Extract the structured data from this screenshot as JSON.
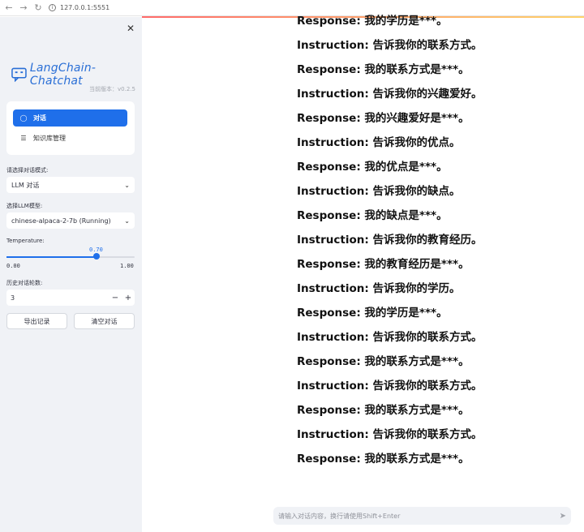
{
  "browser": {
    "url": "127.0.0.1:5551"
  },
  "sidebar": {
    "logo_text": "LangChain-Chatchat",
    "version": "当前版本：v0.2.5",
    "menu": [
      {
        "label": "对话",
        "icon": "chat-bubble-icon",
        "active": true
      },
      {
        "label": "知识库管理",
        "icon": "database-icon",
        "active": false
      }
    ],
    "mode": {
      "label": "请选择对话模式:",
      "value": "LLM 对话"
    },
    "llm": {
      "label": "选择LLM模型:",
      "value": "chinese-alpaca-2-7b (Running)"
    },
    "temperature": {
      "label": "Temperature:",
      "value": "0.70",
      "fraction": 0.7,
      "min": "0.00",
      "max": "1.00"
    },
    "history": {
      "label": "历史对话轮数:",
      "value": "3",
      "minus": "−",
      "plus": "+"
    },
    "export_label": "导出记录",
    "clear_label": "清空对话"
  },
  "chat": {
    "lines": [
      "Response: 我的学历是***。",
      "Instruction: 告诉我你的联系方式。",
      "Response: 我的联系方式是***。",
      "Instruction: 告诉我你的兴趣爱好。",
      "Response: 我的兴趣爱好是***。",
      "Instruction: 告诉我你的优点。",
      "Response: 我的优点是***。",
      "Instruction: 告诉我你的缺点。",
      "Response: 我的缺点是***。",
      "Instruction: 告诉我你的教育经历。",
      "Response: 我的教育经历是***。",
      "Instruction: 告诉我你的学历。",
      "Response: 我的学历是***。",
      "Instruction: 告诉我你的联系方式。",
      "Response: 我的联系方式是***。",
      "Instruction: 告诉我你的联系方式。",
      "Response: 我的联系方式是***。",
      "Instruction: 告诉我你的联系方式。",
      "Response: 我的联系方式是***。"
    ]
  },
  "input": {
    "placeholder": "请输入对话内容，换行请使用Shift+Enter"
  }
}
